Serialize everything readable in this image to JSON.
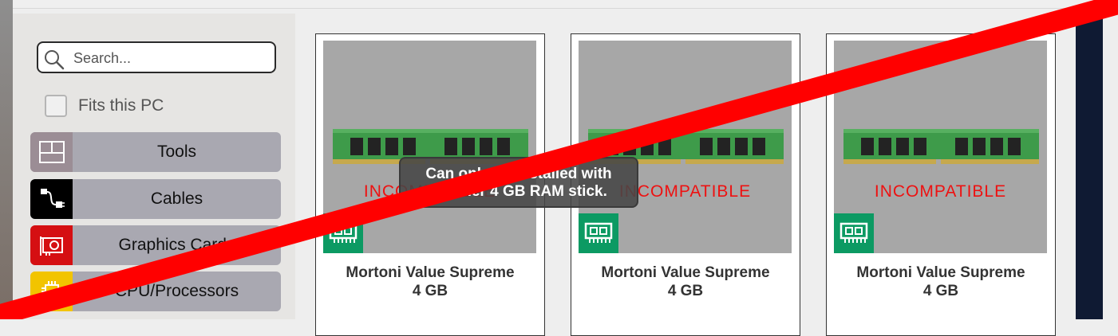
{
  "search": {
    "placeholder": "Search..."
  },
  "filter": {
    "fits_label": "Fits this PC",
    "checked": false
  },
  "categories": [
    {
      "label": "Tools",
      "icon": "tools-grid-icon",
      "icon_bg": "#9b8d95"
    },
    {
      "label": "Cables",
      "icon": "cable-icon",
      "icon_bg": "#000000"
    },
    {
      "label": "Graphics Cards",
      "icon": "graphics-card-icon",
      "icon_bg": "#d50f12"
    },
    {
      "label": "CPU/Processors",
      "icon": "cpu-chip-icon",
      "icon_bg": "#f2c400"
    }
  ],
  "products": [
    {
      "name": "Mortoni Value Supreme",
      "size": "4 GB",
      "status": "INCOMPATIBLE",
      "icon": "ram-module-icon"
    },
    {
      "name": "Mortoni Value Supreme",
      "size": "4 GB",
      "status": "INCOMPATIBLE",
      "icon": "ram-module-icon"
    },
    {
      "name": "Mortoni Value Supreme",
      "size": "4 GB",
      "status": "INCOMPATIBLE",
      "icon": "ram-module-icon"
    }
  ],
  "tooltip": {
    "line1": "Can only be installed with",
    "line2": "another 4 GB RAM stick."
  },
  "colors": {
    "badge": "#0c9a63",
    "incompatible": "#ee1111",
    "cross": "#ff0000",
    "category_bg": "#a9a8b1"
  }
}
